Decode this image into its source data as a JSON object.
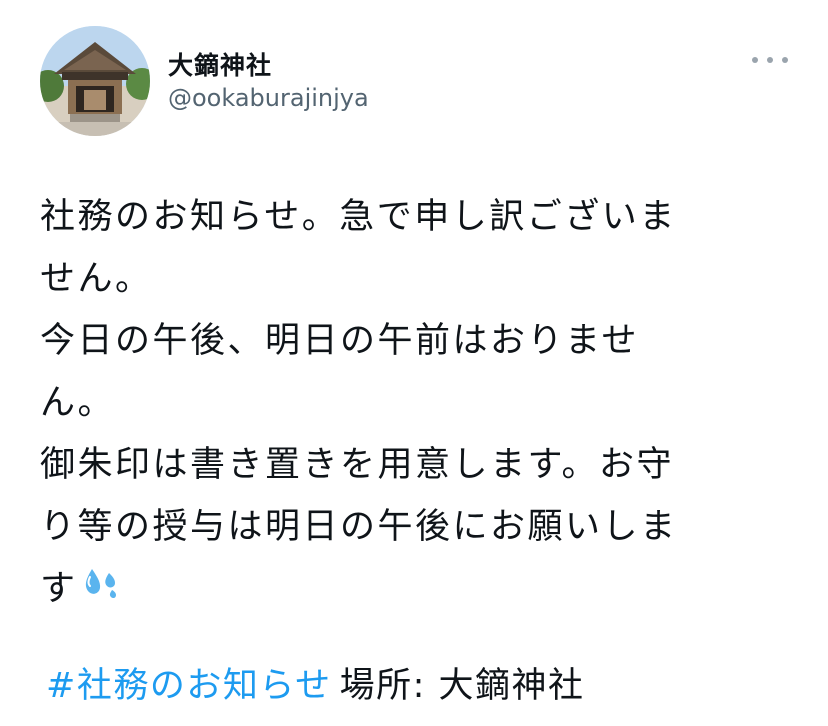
{
  "author": {
    "display_name": "大鏑神社",
    "handle": "@ookaburajinjya"
  },
  "tweet": {
    "lines": [
      "社務のお知らせ。急で申し訳ございま",
      "せん。",
      "今日の午後、明日の午前はおりませ",
      "ん。",
      "御朱印は書き置きを用意します。お守",
      "り等の授与は明日の午後にお願いしま",
      "す"
    ],
    "emoji": "sweat-droplets-icon",
    "hashtag": "#社務のお知らせ",
    "location": "場所: 大鏑神社"
  },
  "colors": {
    "link": "#1d9bf0",
    "text": "#0f1419",
    "secondary": "#536471"
  }
}
